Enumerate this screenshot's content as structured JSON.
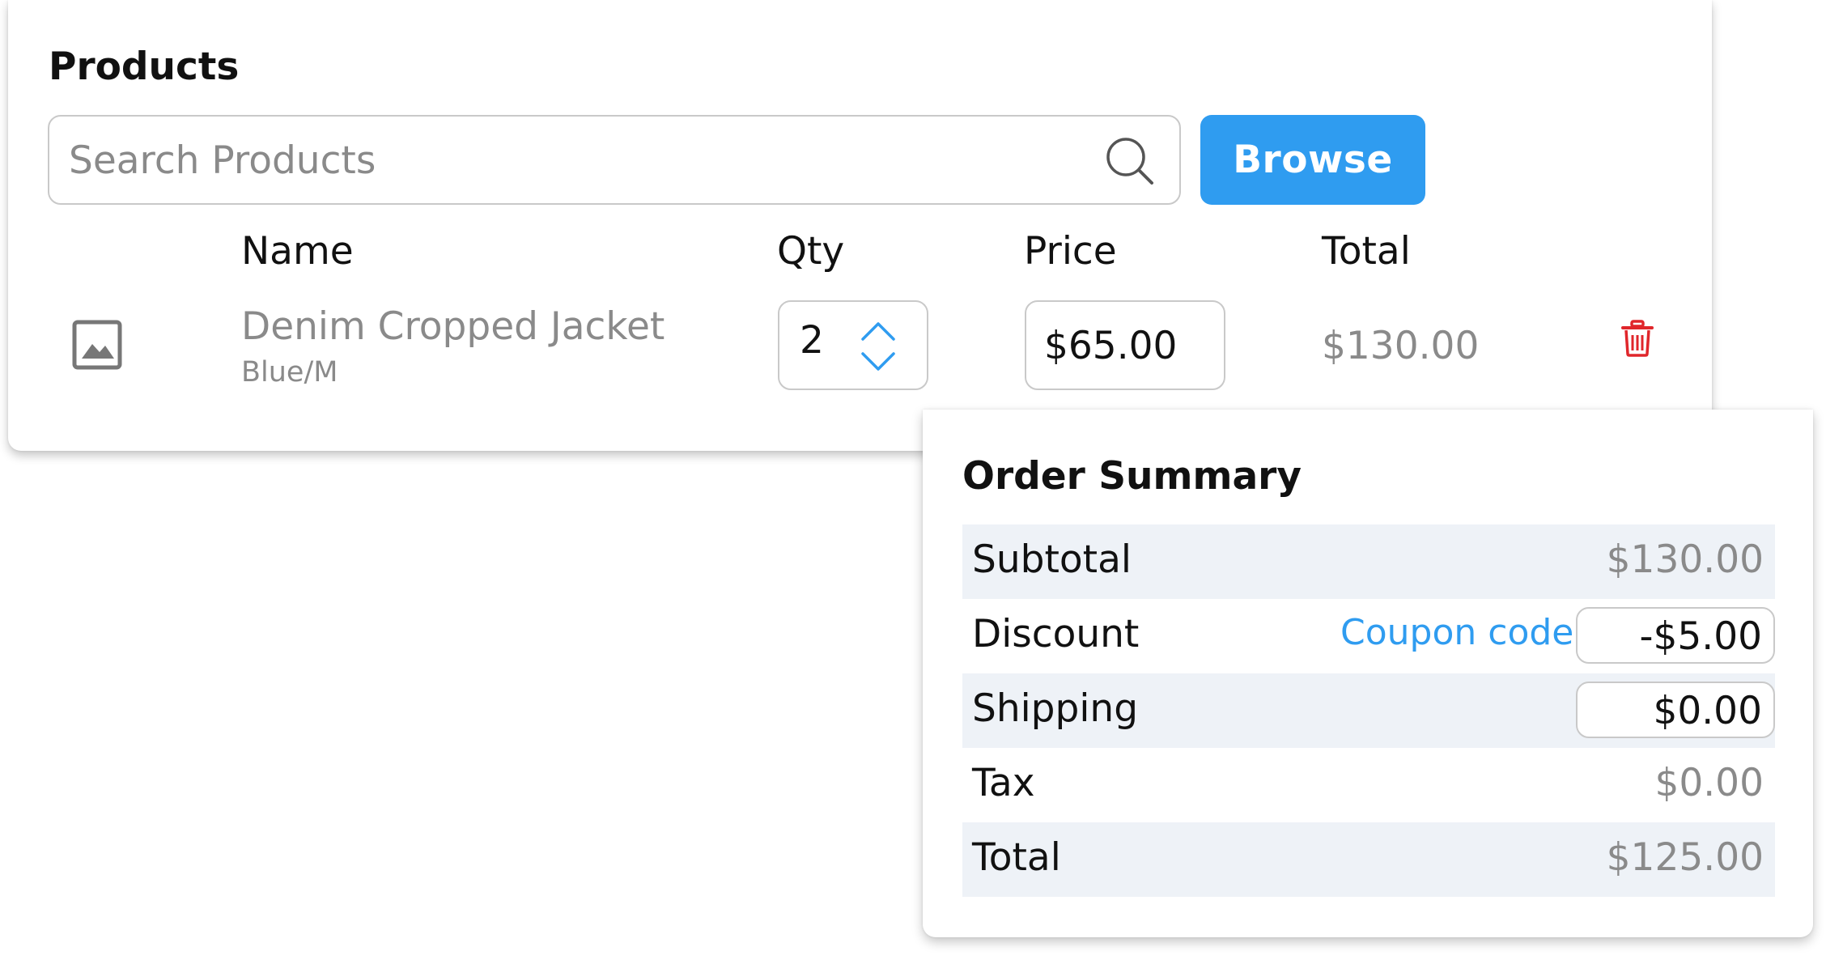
{
  "products": {
    "title": "Products",
    "search": {
      "placeholder": "Search Products",
      "value": ""
    },
    "browse_label": "Browse",
    "columns": {
      "name": "Name",
      "qty": "Qty",
      "price": "Price",
      "total": "Total"
    },
    "items": [
      {
        "name": "Denim Cropped Jacket",
        "variant": "Blue/M",
        "qty": "2",
        "price": "$65.00",
        "total": "$130.00"
      }
    ]
  },
  "order_summary": {
    "title": "Order Summary",
    "subtotal": {
      "label": "Subtotal",
      "value": "$130.00"
    },
    "discount": {
      "label": "Discount",
      "coupon_link": "Coupon code",
      "value": "-$5.00"
    },
    "shipping": {
      "label": "Shipping",
      "value": "$0.00"
    },
    "tax": {
      "label": "Tax",
      "value": "$0.00"
    },
    "total": {
      "label": "Total",
      "value": "$125.00"
    }
  },
  "colors": {
    "accent": "#2f9cf0",
    "delete": "#e0262b",
    "muted_text": "#8a8a8a",
    "row_shade": "#eef2f7"
  },
  "icons": {
    "search": "search-icon",
    "product_image": "image-icon",
    "qty_up": "chevron-up-icon",
    "qty_down": "chevron-down-icon",
    "delete": "trash-icon"
  }
}
